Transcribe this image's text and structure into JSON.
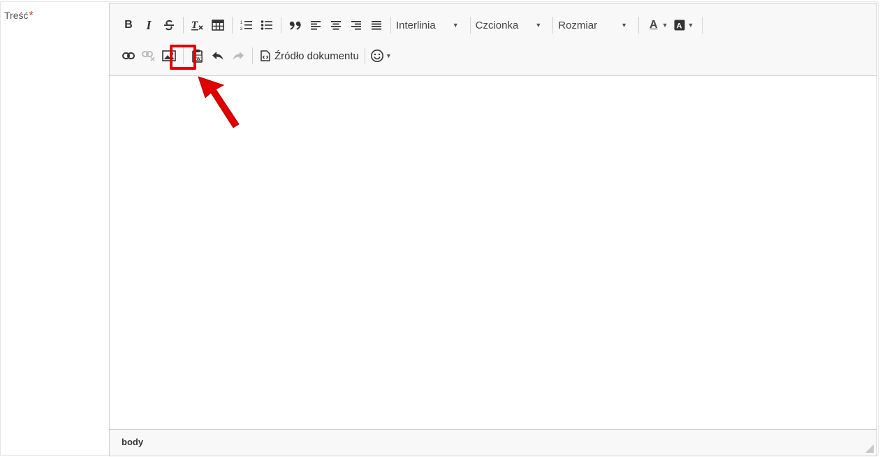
{
  "form": {
    "label": "Treść",
    "required_marker": "*"
  },
  "toolbar": {
    "row1": {
      "bold": "B",
      "italic": "I",
      "line_height": "Interlinia",
      "font": "Czcionka",
      "size": "Rozmiar",
      "text_color": "A"
    },
    "row2": {
      "source": "Źródło dokumentu"
    }
  },
  "statusbar": {
    "path": "body"
  },
  "colors": {
    "highlight": "#e00000",
    "required": "#e52420"
  }
}
